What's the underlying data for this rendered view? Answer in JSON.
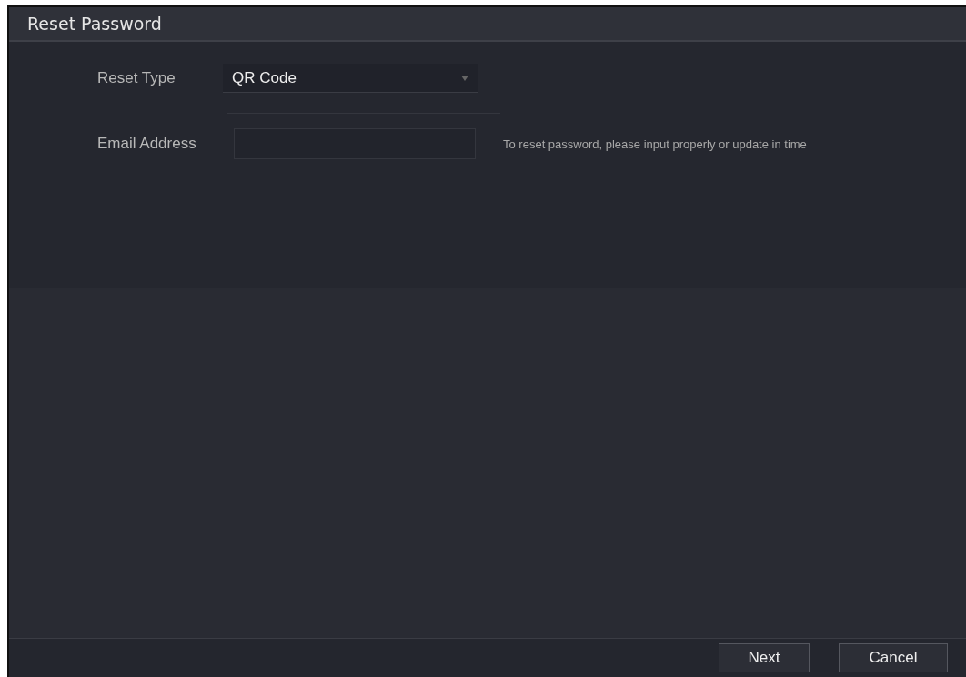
{
  "window": {
    "title": "Reset Password"
  },
  "form": {
    "reset_type": {
      "label": "Reset Type",
      "value": "QR Code"
    },
    "email": {
      "label": "Email Address",
      "hint": "To reset password, please input properly or update in time"
    }
  },
  "buttons": [
    {
      "label": "Next"
    },
    {
      "label": "Cancel"
    }
  ]
}
